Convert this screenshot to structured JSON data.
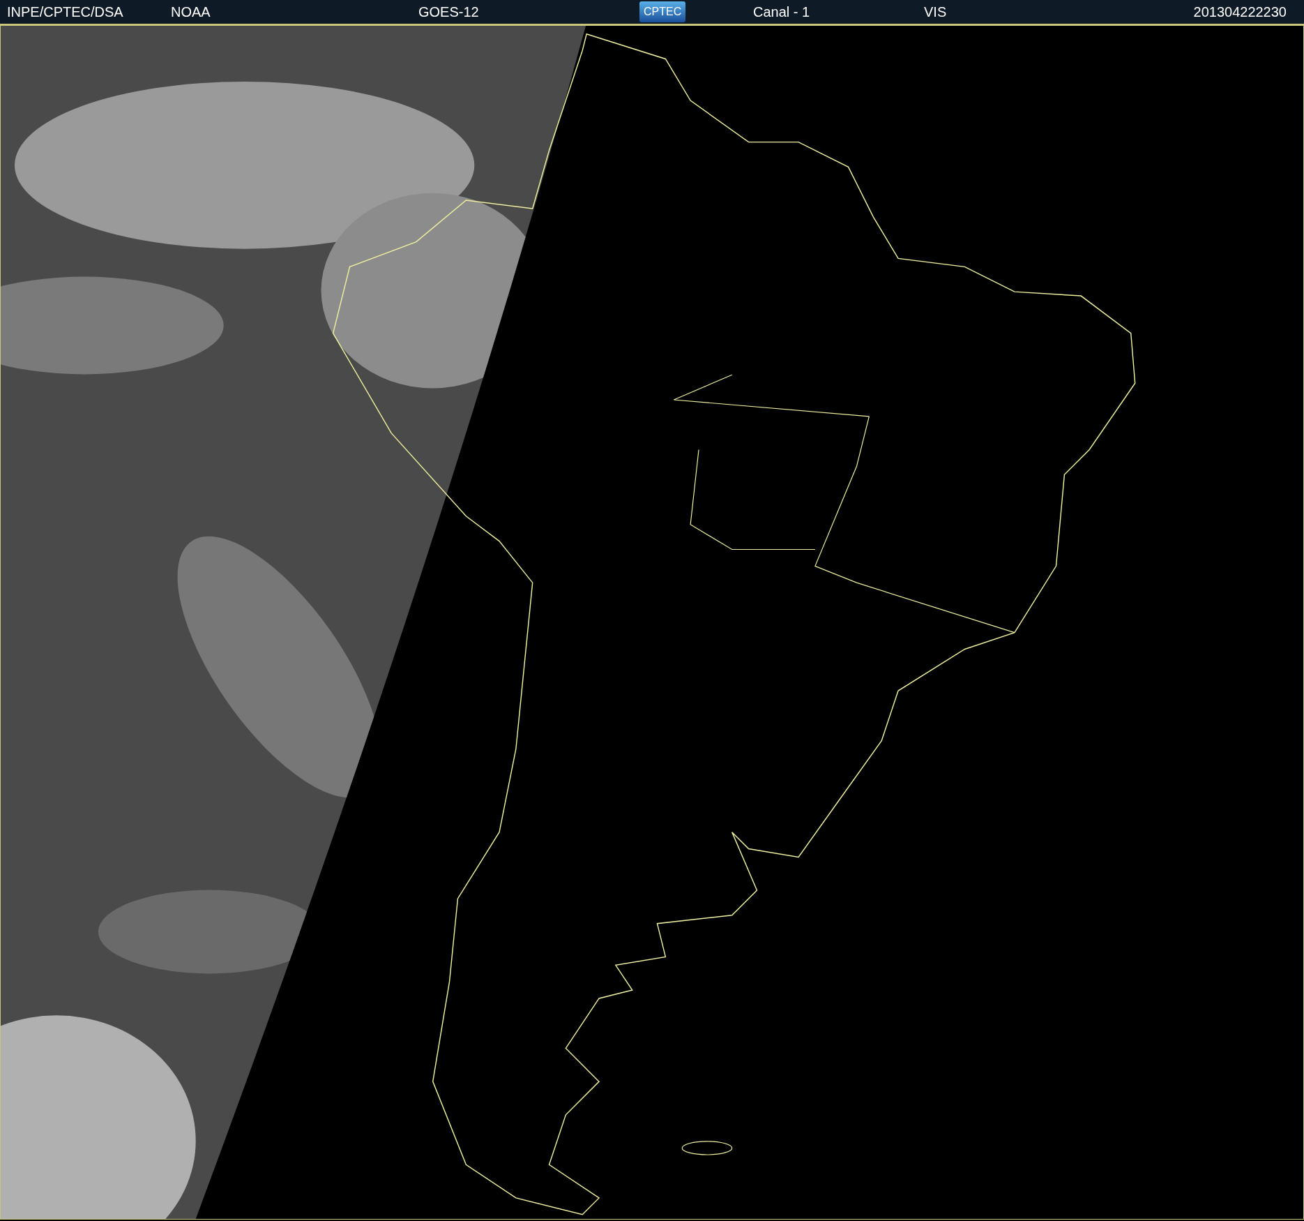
{
  "header": {
    "agency": "INPE/CPTEC/DSA",
    "source": "NOAA",
    "satellite": "GOES-12",
    "logo": "CPTEC",
    "channel": "Canal - 1",
    "band": "VIS",
    "timestamp": "201304222230"
  }
}
